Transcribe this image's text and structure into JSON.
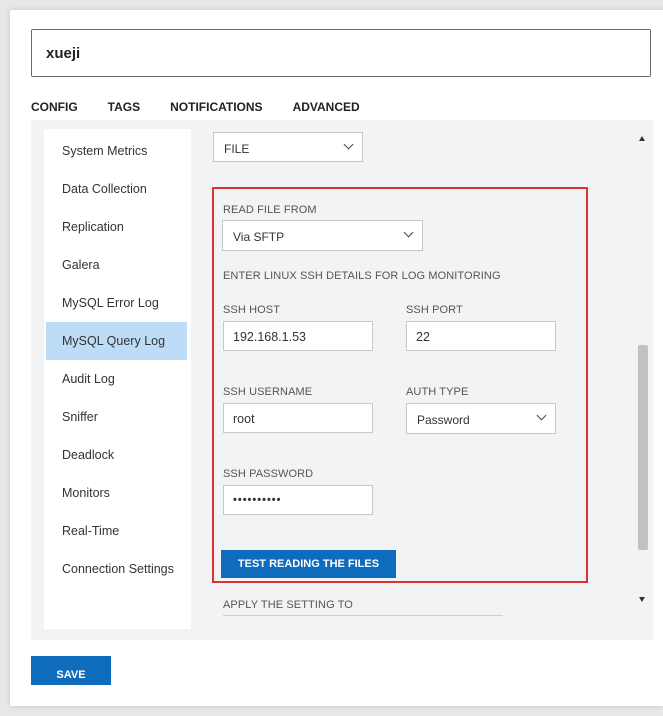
{
  "header": {
    "name_value": "xueji"
  },
  "tabs": [
    {
      "label": "CONFIG",
      "active": false
    },
    {
      "label": "TAGS",
      "active": false
    },
    {
      "label": "NOTIFICATIONS",
      "active": false
    },
    {
      "label": "ADVANCED",
      "active": true
    }
  ],
  "sidebar": {
    "items": [
      {
        "label": "System Metrics"
      },
      {
        "label": "Data Collection"
      },
      {
        "label": "Replication"
      },
      {
        "label": "Galera"
      },
      {
        "label": "MySQL Error Log"
      },
      {
        "label": "MySQL Query Log",
        "active": true
      },
      {
        "label": "Audit Log"
      },
      {
        "label": "Sniffer"
      },
      {
        "label": "Deadlock"
      },
      {
        "label": "Monitors"
      },
      {
        "label": "Real-Time"
      },
      {
        "label": "Connection Settings"
      }
    ]
  },
  "form": {
    "top_select_value": "FILE",
    "read_from_label": "READ FILE FROM",
    "read_from_value": "Via SFTP",
    "ssh_section_label": "ENTER LINUX SSH DETAILS FOR LOG MONITORING",
    "ssh_host_label": "SSH HOST",
    "ssh_host_value": "192.168.1.53",
    "ssh_port_label": "SSH PORT",
    "ssh_port_value": "22",
    "ssh_username_label": "SSH USERNAME",
    "ssh_username_value": "root",
    "auth_type_label": "AUTH TYPE",
    "auth_type_value": "Password",
    "ssh_password_label": "SSH PASSWORD",
    "ssh_password_value": "••••••••••",
    "test_button_label": "TEST READING THE FILES",
    "apply_label": "APPLY THE SETTING TO"
  },
  "footer": {
    "save_label": "SAVE"
  },
  "colors": {
    "accent": "#0f6cbd",
    "highlight_box": "#e03131",
    "active_item": "#bcdcf7"
  }
}
